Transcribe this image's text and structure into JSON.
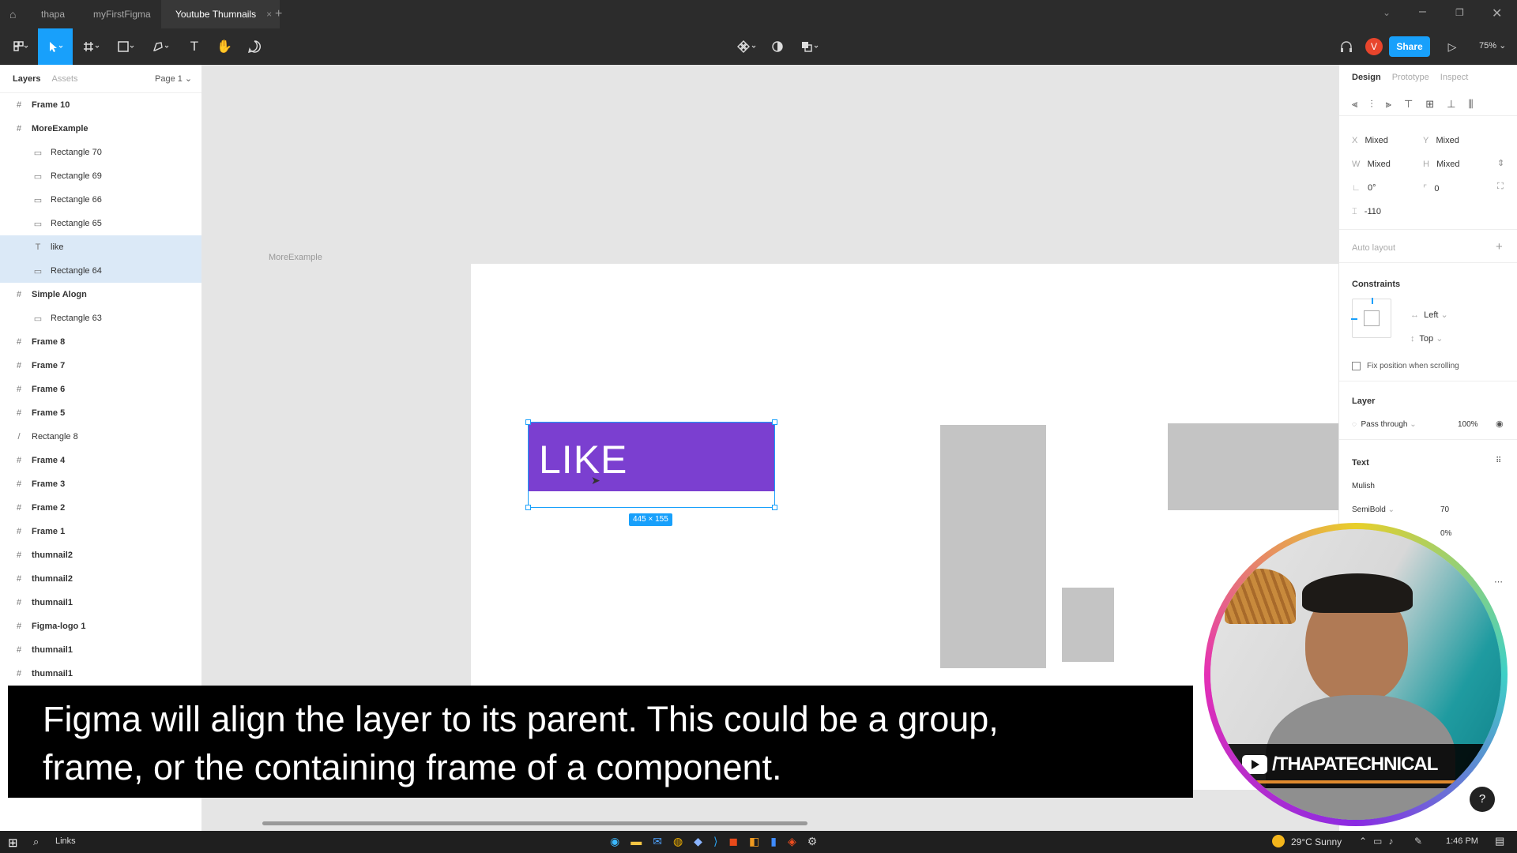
{
  "tabs": [
    "thapa",
    "myFirstFigma",
    "Youtube Thumnails"
  ],
  "toolbar": {
    "share_label": "Share",
    "zoom": "75%",
    "avatar_letter": "V"
  },
  "left_panel": {
    "tab_layers": "Layers",
    "tab_assets": "Assets",
    "page": "Page 1",
    "layers": [
      {
        "name": "Frame 10",
        "type": "frame"
      },
      {
        "name": "MoreExample",
        "type": "frame"
      },
      {
        "name": "Rectangle 70",
        "type": "rect"
      },
      {
        "name": "Rectangle 69",
        "type": "rect"
      },
      {
        "name": "Rectangle 66",
        "type": "rect"
      },
      {
        "name": "Rectangle 65",
        "type": "rect"
      },
      {
        "name": "like",
        "type": "text"
      },
      {
        "name": "Rectangle 64",
        "type": "rect"
      },
      {
        "name": "Simple Alogn",
        "type": "frame"
      },
      {
        "name": "Rectangle 63",
        "type": "rect"
      },
      {
        "name": "Frame 8",
        "type": "frame"
      },
      {
        "name": "Frame 7",
        "type": "frame"
      },
      {
        "name": "Frame 6",
        "type": "frame"
      },
      {
        "name": "Frame 5",
        "type": "frame"
      },
      {
        "name": "Rectangle 8",
        "type": "line"
      },
      {
        "name": "Frame 4",
        "type": "frame"
      },
      {
        "name": "Frame 3",
        "type": "frame"
      },
      {
        "name": "Frame 2",
        "type": "frame"
      },
      {
        "name": "Frame 1",
        "type": "frame"
      },
      {
        "name": "thumnail2",
        "type": "frame"
      },
      {
        "name": "thumnail2",
        "type": "frame"
      },
      {
        "name": "thumnail1",
        "type": "frame"
      },
      {
        "name": "Figma-logo 1",
        "type": "frame"
      },
      {
        "name": "thumnail1",
        "type": "frame"
      },
      {
        "name": "thumnail1",
        "type": "frame"
      }
    ]
  },
  "canvas": {
    "frame_label": "MoreExample",
    "like_text": "LIKE",
    "size_badge": "445 × 155"
  },
  "right_panel": {
    "tab_design": "Design",
    "tab_prototype": "Prototype",
    "tab_inspect": "Inspect",
    "x_label": "X",
    "x_value": "Mixed",
    "y_label": "Y",
    "y_value": "Mixed",
    "w_label": "W",
    "w_value": "Mixed",
    "h_label": "H",
    "h_value": "Mixed",
    "rotation": "0°",
    "radius": "0",
    "spacing": "-110",
    "auto_layout": "Auto layout",
    "constraints": "Constraints",
    "constraint_h": "Left",
    "constraint_v": "Top",
    "fix_position": "Fix position when scrolling",
    "layer_title": "Layer",
    "blend": "Pass through",
    "opacity": "100%",
    "text_title": "Text",
    "font": "Mulish",
    "weight": "SemiBold",
    "font_size": "70",
    "letter_spacing": "0%"
  },
  "caption": {
    "line1": "Figma will align the layer to its parent. This could be a group,",
    "line2": "frame, or the containing frame of a component."
  },
  "webcam": {
    "channel": "/THAPATECHNICAL"
  },
  "taskbar": {
    "search": "Links",
    "weather": "29°C  Sunny",
    "time": "1:46 PM"
  },
  "colors": {
    "accent": "#18a0fb",
    "like_fill": "#7b3fd0",
    "placeholder": "#c4c4c4",
    "avatar": "#e8452c"
  }
}
